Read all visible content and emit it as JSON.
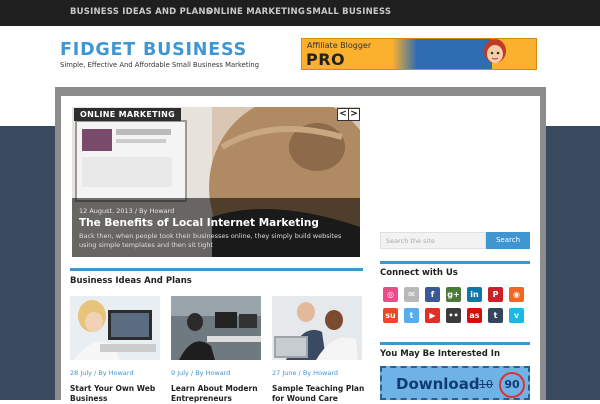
{
  "nav": {
    "items": [
      "BUSINESS IDEAS AND PLANS",
      "ONLINE MARKETING",
      "SMALL BUSINESS"
    ]
  },
  "header": {
    "title": "FIDGET BUSINESS",
    "tagline": "Simple, Effective And Affordable Small Business Marketing",
    "ad": {
      "line1": "Affiliate Blogger",
      "line2": "PRO"
    }
  },
  "slider": {
    "category": "ONLINE MARKETING",
    "prev": "<",
    "next": ">",
    "meta": "12 August, 2013 / By Howard",
    "title": "The Benefits of Local Internet Marketing",
    "excerpt": "Back then, when people took their businesses online, they simply build websites using simple templates and then sit tight"
  },
  "section": {
    "title": "Business Ideas And Plans",
    "posts": [
      {
        "date": "28 July / By Howard",
        "title": "Start Your Own Web Business"
      },
      {
        "date": "9 July / By Howard",
        "title": "Learn About Modern Entrepreneurs"
      },
      {
        "date": "27 June / By Howard",
        "title": "Sample Teaching Plan for Wound Care"
      }
    ]
  },
  "sidebar": {
    "search_placeholder": "Search the site",
    "search_button": "Search",
    "connect_title": "Connect with Us",
    "social_row1": [
      {
        "icon": "dribbble-icon",
        "glyph": "◎",
        "color": "#ea4c89"
      },
      {
        "icon": "email-icon",
        "glyph": "✉",
        "color": "#b8b8b8"
      },
      {
        "icon": "facebook-icon",
        "glyph": "f",
        "color": "#3b5998"
      },
      {
        "icon": "google-plus-icon",
        "glyph": "g+",
        "color": "#4a7a3a"
      },
      {
        "icon": "linkedin-icon",
        "glyph": "in",
        "color": "#0e76a8"
      },
      {
        "icon": "pinterest-icon",
        "glyph": "P",
        "color": "#cb2027"
      },
      {
        "icon": "rss-icon",
        "glyph": "◉",
        "color": "#f26522"
      }
    ],
    "social_row2": [
      {
        "icon": "stumbleupon-icon",
        "glyph": "su",
        "color": "#eb4924"
      },
      {
        "icon": "twitter-icon",
        "glyph": "t",
        "color": "#55acee"
      },
      {
        "icon": "youtube-icon",
        "glyph": "▶",
        "color": "#e52d27"
      },
      {
        "icon": "flickr-icon",
        "glyph": "••",
        "color": "#3b3b3b"
      },
      {
        "icon": "lastfm-icon",
        "glyph": "as",
        "color": "#d51007"
      },
      {
        "icon": "tumblr-icon",
        "glyph": "t",
        "color": "#35465c"
      },
      {
        "icon": "vimeo-icon",
        "glyph": "v",
        "color": "#1ab7ea"
      }
    ],
    "interested_title": "You May Be Interested In",
    "ad": {
      "download": "Download",
      "old_price": "10",
      "new_price": "90"
    }
  }
}
